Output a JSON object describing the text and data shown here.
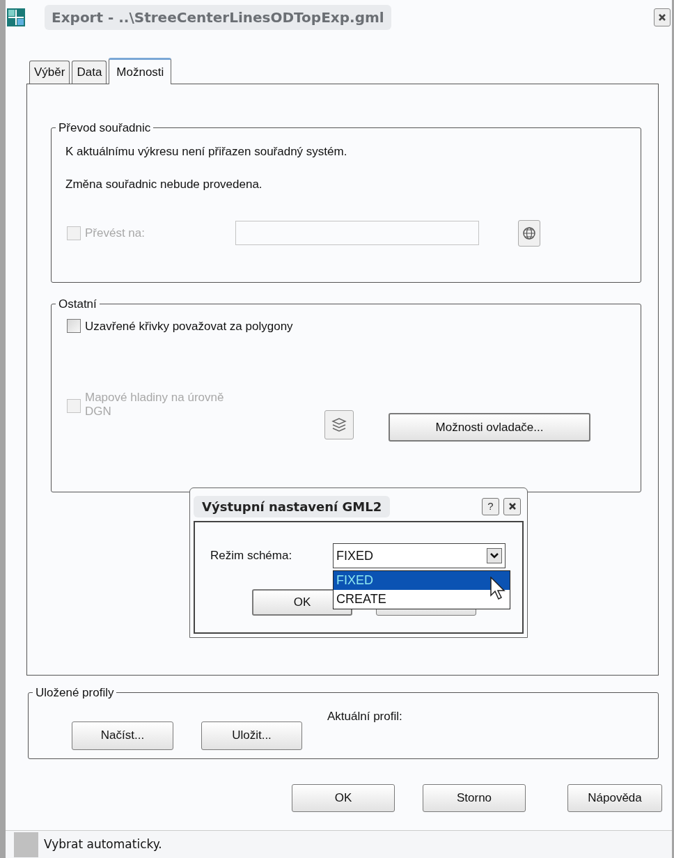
{
  "window": {
    "title": "Export - ..\\StreeCenterLinesODTopExp.gml"
  },
  "tabs": [
    {
      "label": "Výběr",
      "selected": false
    },
    {
      "label": "Data",
      "selected": false
    },
    {
      "label": "Možnosti",
      "selected": true
    }
  ],
  "coordinate_group": {
    "title": "Převod souřadnic",
    "messages": [
      "K aktuálnímu výkresu není přiřazen souřadný systém.",
      "Změna souřadnic nebude provedena."
    ],
    "convert": {
      "label": "Převést na:",
      "checked": false,
      "disabled": true
    }
  },
  "other_group": {
    "title": "Ostatní",
    "options": [
      {
        "label": "Uzavřené křivky považovat za polygony",
        "checked": false,
        "disabled": false
      },
      {
        "label": "Mapové hladiny na úrovně DGN",
        "checked": false,
        "disabled": true
      }
    ],
    "driver_button": "Možnosti ovladače..."
  },
  "popup": {
    "title": "Výstupní nastavení GML2",
    "help": "?",
    "field_label": "Režim schéma:",
    "value": "FIXED",
    "options": [
      {
        "label": "FIXED",
        "selected": true
      },
      {
        "label": "CREATE",
        "selected": false
      }
    ],
    "ok": "OK"
  },
  "profiles_group": {
    "title": "Uložené profily",
    "buttons": [
      "Načíst...",
      "Uložit..."
    ],
    "current_label": "Aktuální profil:"
  },
  "buttons": [
    "OK",
    "Storno",
    "Nápověda"
  ],
  "status_bar": "Vybrat automaticky."
}
